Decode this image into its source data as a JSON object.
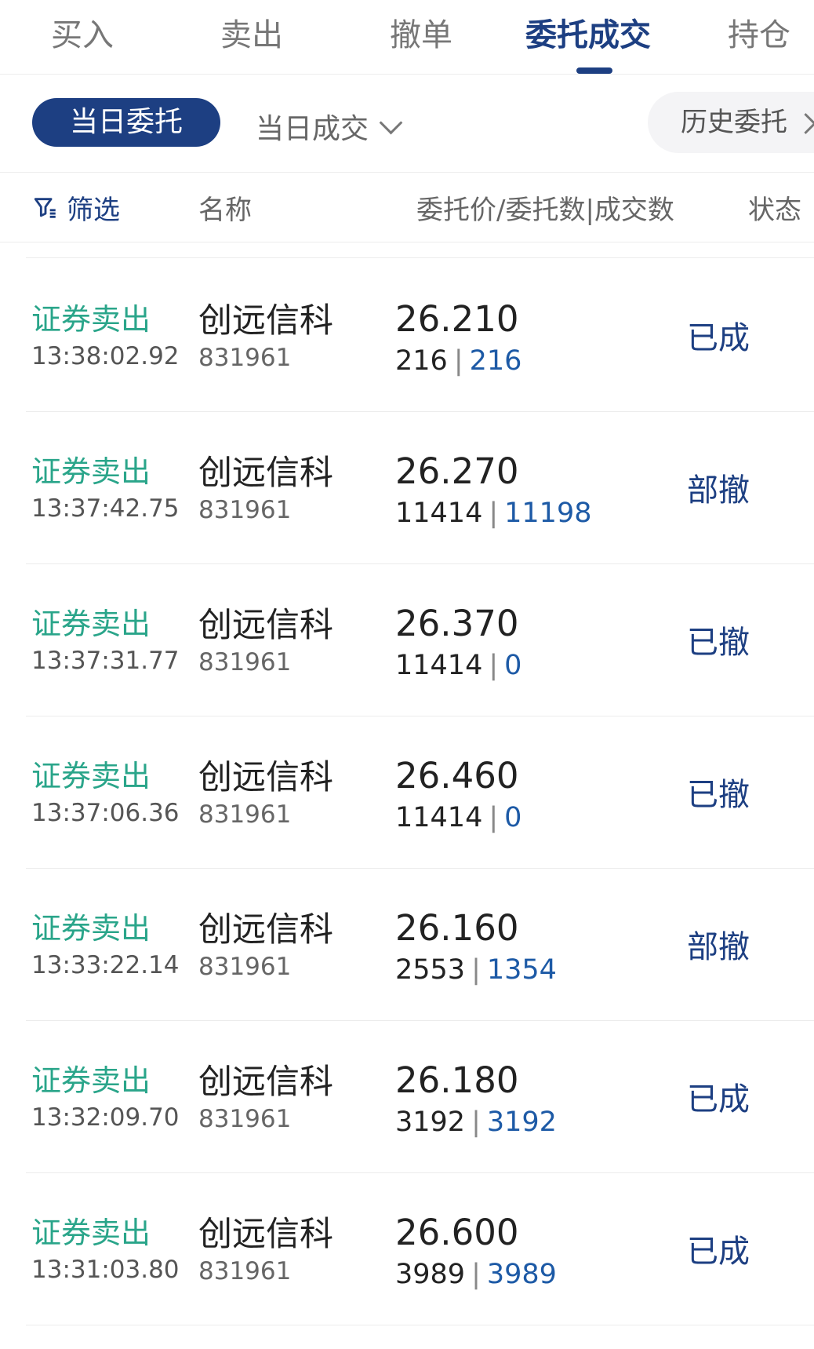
{
  "tabs": [
    {
      "label": "买入"
    },
    {
      "label": "卖出"
    },
    {
      "label": "撤单"
    },
    {
      "label": "委托成交"
    },
    {
      "label": "持仓"
    }
  ],
  "subtabs": {
    "today_orders": "当日委托",
    "today_deals": "当日成交",
    "history_orders": "历史委托"
  },
  "header": {
    "filter": "筛选",
    "name": "名称",
    "price_qty": "委托价/委托数|成交数",
    "status": "状态"
  },
  "orders": [
    {
      "type": "证券卖出",
      "time": "13:38:02.92",
      "name": "创远信科",
      "code": "831961",
      "price": "26.210",
      "order_qty": "216",
      "deal_qty": "216",
      "status": "已成"
    },
    {
      "type": "证券卖出",
      "time": "13:37:42.75",
      "name": "创远信科",
      "code": "831961",
      "price": "26.270",
      "order_qty": "11414",
      "deal_qty": "11198",
      "status": "部撤"
    },
    {
      "type": "证券卖出",
      "time": "13:37:31.77",
      "name": "创远信科",
      "code": "831961",
      "price": "26.370",
      "order_qty": "11414",
      "deal_qty": "0",
      "status": "已撤"
    },
    {
      "type": "证券卖出",
      "time": "13:37:06.36",
      "name": "创远信科",
      "code": "831961",
      "price": "26.460",
      "order_qty": "11414",
      "deal_qty": "0",
      "status": "已撤"
    },
    {
      "type": "证券卖出",
      "time": "13:33:22.14",
      "name": "创远信科",
      "code": "831961",
      "price": "26.160",
      "order_qty": "2553",
      "deal_qty": "1354",
      "status": "部撤"
    },
    {
      "type": "证券卖出",
      "time": "13:32:09.70",
      "name": "创远信科",
      "code": "831961",
      "price": "26.180",
      "order_qty": "3192",
      "deal_qty": "3192",
      "status": "已成"
    },
    {
      "type": "证券卖出",
      "time": "13:31:03.80",
      "name": "创远信科",
      "code": "831961",
      "price": "26.600",
      "order_qty": "3989",
      "deal_qty": "3989",
      "status": "已成"
    }
  ],
  "colors": {
    "brand": "#1d3f82",
    "sell_type": "#2aa58a",
    "deal_qty": "#1d5aa6"
  }
}
